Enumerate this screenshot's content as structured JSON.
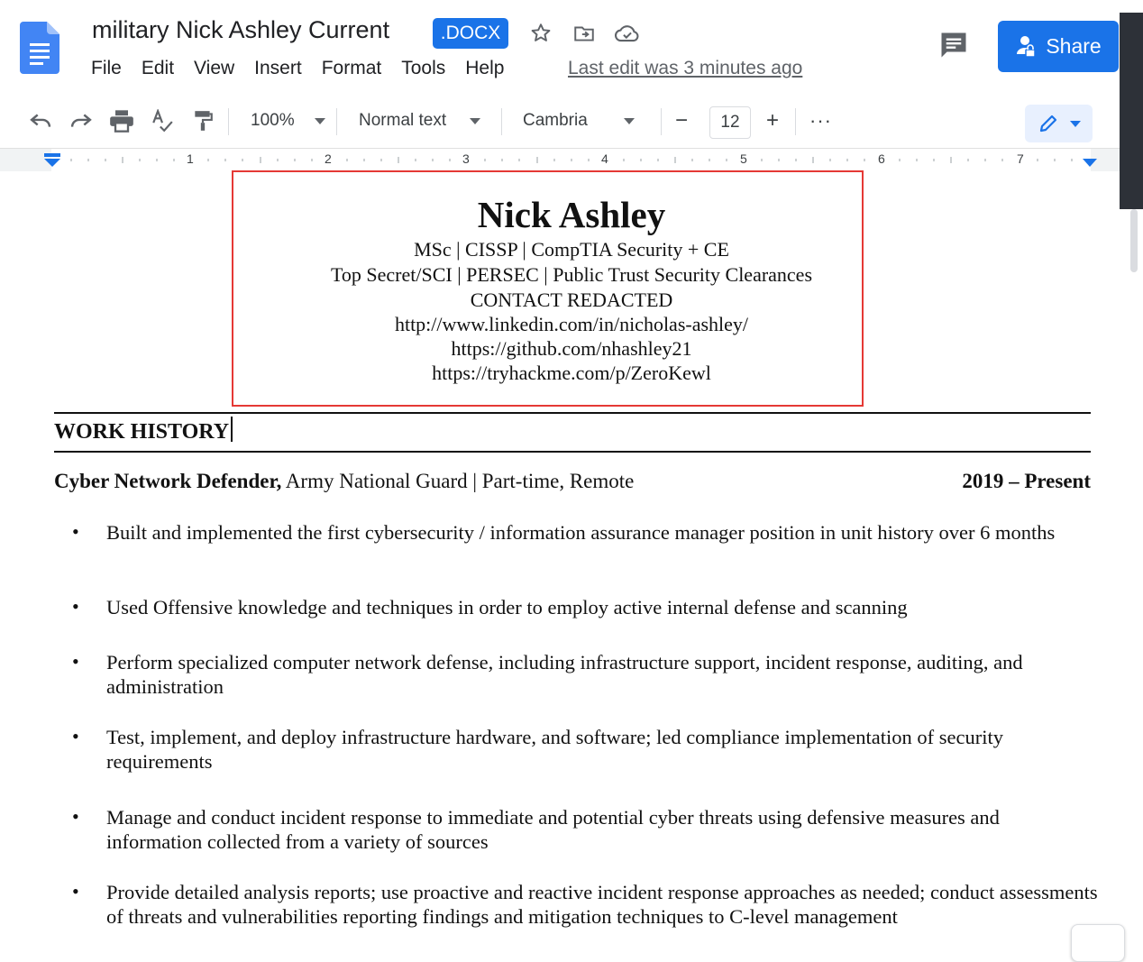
{
  "header": {
    "doc_title": "military Nick Ashley Current",
    "badge": ".DOCX",
    "menu": [
      "File",
      "Edit",
      "View",
      "Insert",
      "Format",
      "Tools",
      "Help"
    ],
    "last_edit": "Last edit was 3 minutes ago",
    "share_label": "Share",
    "icons": [
      "docs-logo-icon",
      "star-icon",
      "move-to-folder-icon",
      "cloud-saved-icon",
      "comments-icon",
      "person-lock-icon"
    ]
  },
  "toolbar": {
    "zoom": "100%",
    "style": "Normal text",
    "font": "Cambria",
    "font_size": "12",
    "minus": "−",
    "plus": "+",
    "more": "···",
    "icons": [
      "undo-icon",
      "redo-icon",
      "print-icon",
      "spellcheck-icon",
      "paint-format-icon",
      "pencil-icon"
    ]
  },
  "ruler": {
    "numbers": [
      "1",
      "2",
      "3",
      "4",
      "5",
      "6",
      "7"
    ]
  },
  "resume": {
    "name": "Nick Ashley",
    "credentials": "MSc | CISSP | CompTIA Security + CE",
    "clearances": "Top Secret/SCI | PERSEC | Public Trust Security Clearances",
    "contact": "CONTACT REDACTED",
    "linkedin": "http://www.linkedin.com/in/nicholas-ashley/",
    "github": "https://github.com/nhashley21",
    "tryhackme": "https://tryhackme.com/p/ZeroKewl",
    "section_title": "WORK HISTORY",
    "job": {
      "title": "Cyber Network Defender,",
      "org": " Army National Guard | Part-time, Remote",
      "dates": "2019 – Present"
    },
    "bullets": [
      "Built and implemented the first cybersecurity / information assurance manager position in unit history over 6 months",
      "Used Offensive knowledge and techniques in order to employ active internal defense and scanning",
      "Perform specialized computer network defense, including infrastructure support, incident response, auditing, and administration",
      "Test, implement, and deploy infrastructure hardware, and software; led compliance implementation of security requirements",
      "Manage and conduct incident response to immediate and potential cyber threats using defensive measures and information collected from a variety of sources",
      "Provide detailed analysis reports; use proactive and reactive incident response approaches as needed; conduct assessments of threats and vulnerabilities reporting findings and mitigation techniques to C-level management"
    ]
  }
}
